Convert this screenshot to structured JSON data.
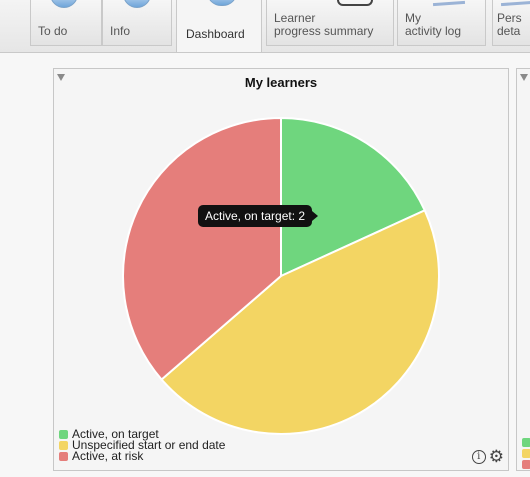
{
  "tabs": [
    {
      "label_lines": [
        "To do"
      ],
      "active": false
    },
    {
      "label_lines": [
        "Info"
      ],
      "active": false
    },
    {
      "label_lines": [
        "Dashboard"
      ],
      "active": true
    },
    {
      "label_lines": [
        "Learner",
        "progress summary"
      ],
      "active": false
    },
    {
      "label_lines": [
        "My",
        "activity log"
      ],
      "active": false
    },
    {
      "label_lines": [
        "Pers",
        "deta"
      ],
      "active": false
    }
  ],
  "panel": {
    "title": "My learners",
    "tooltip": "Active, on target: 2",
    "info_icon": "info-icon",
    "settings_icon": "gear-icon"
  },
  "colors": {
    "on_target": "#6fd67e",
    "unspecified": "#f3d563",
    "at_risk": "#e57e7b"
  },
  "chart_data": {
    "type": "pie",
    "title": "My learners",
    "legend_position": "bottom-left",
    "slices": [
      {
        "label": "Active, on target",
        "value": 2,
        "color": "#6fd67e"
      },
      {
        "label": "Unspecified start or end date",
        "value": 5,
        "color": "#f3d563"
      },
      {
        "label": "Active, at risk",
        "value": 4,
        "color": "#e57e7b"
      }
    ]
  }
}
